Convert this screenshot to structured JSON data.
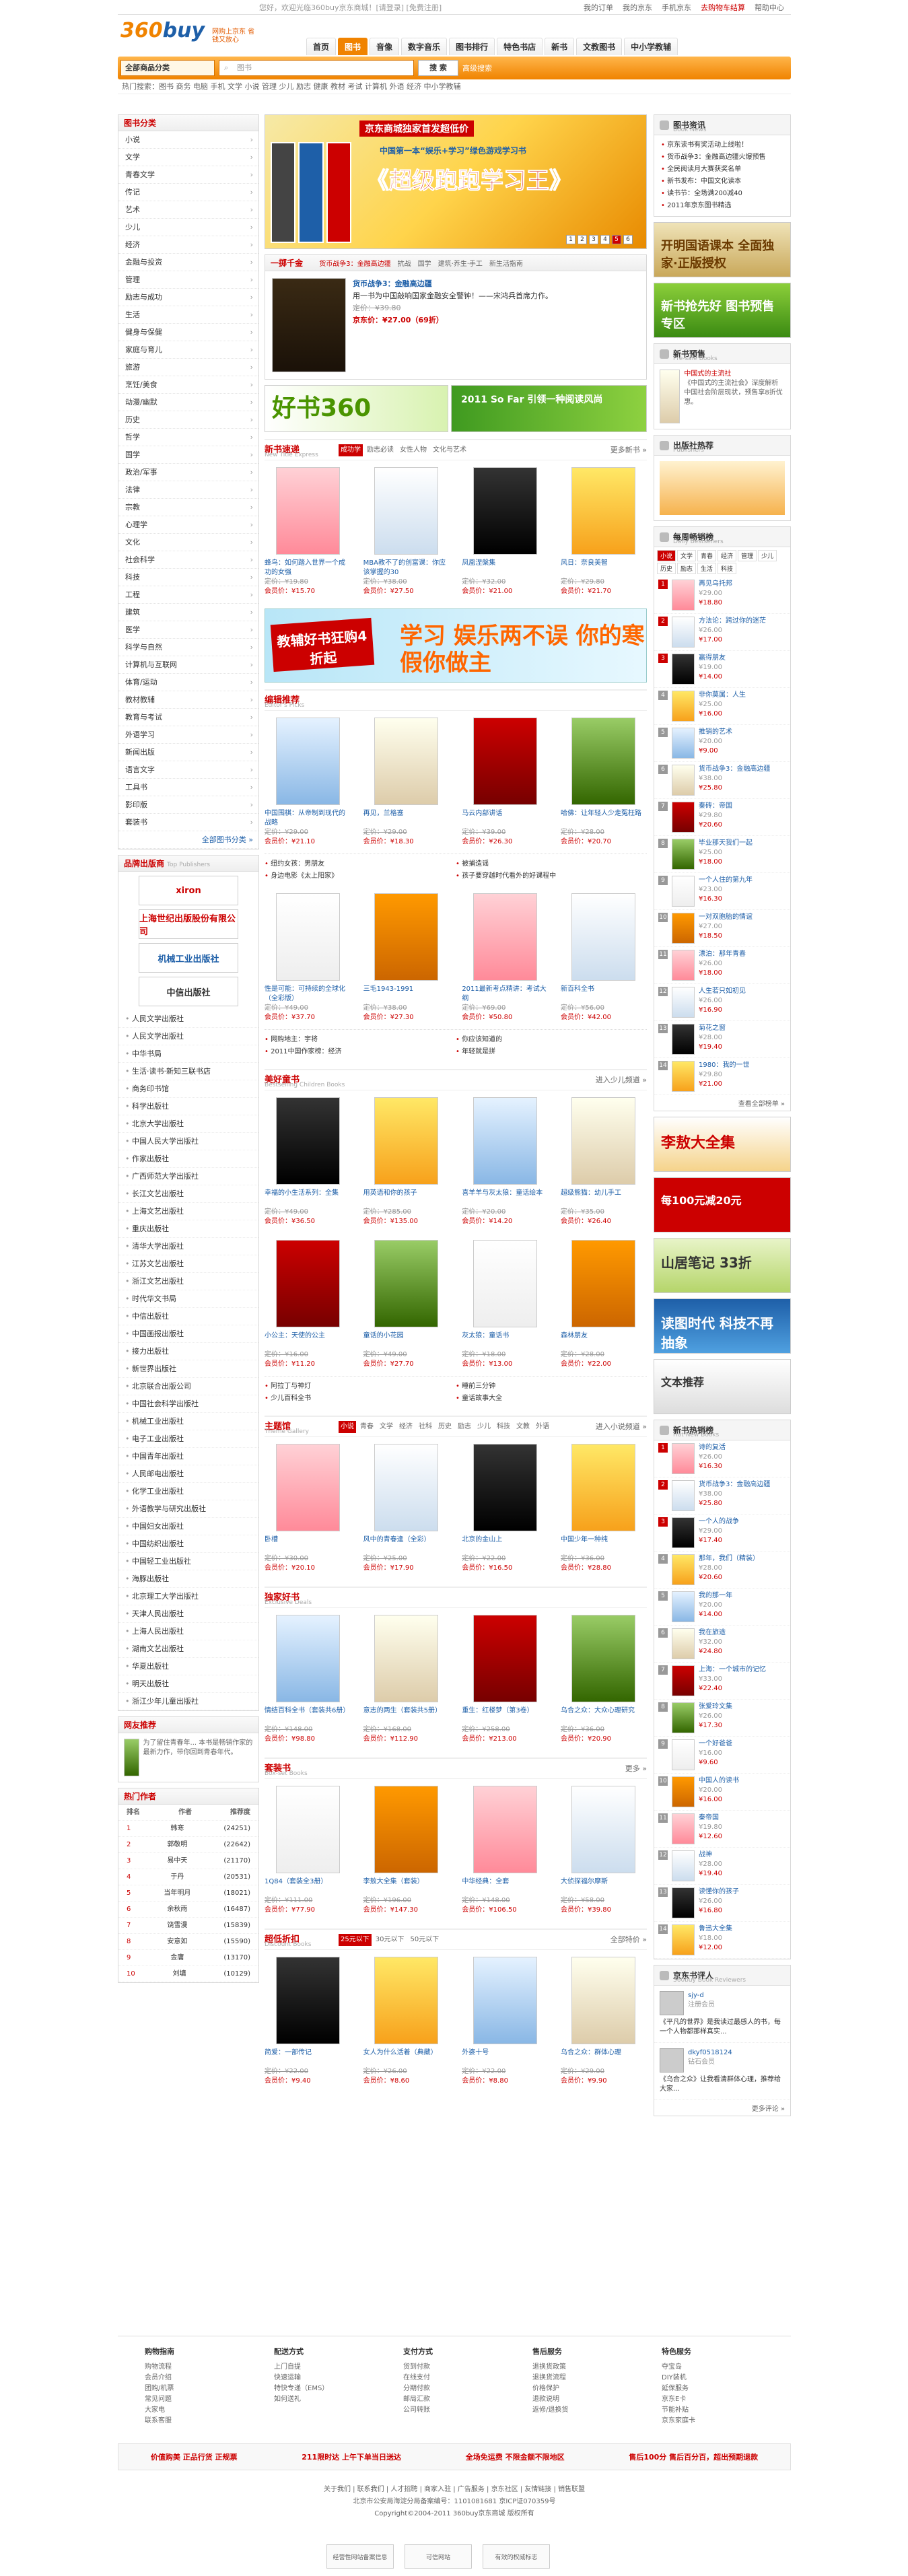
{
  "topbar": {
    "welcome": "您好，欢迎光临360buy京东商城！[请登录] [免费注册]",
    "links": [
      "我的订单",
      "我的京东",
      "手机京东",
      "去购物车结算",
      "帮助中心"
    ],
    "cart": "购物车"
  },
  "header": {
    "logo": "360buy",
    "slogan": "网购上京东 省钱又放心",
    "nav": [
      "首页",
      "图书",
      "音像",
      "数字音乐",
      "图书排行",
      "特色书店",
      "新书",
      "文教图书",
      "中小学教辅"
    ],
    "nav_on": 1
  },
  "search": {
    "category": "全部商品分类",
    "placeholder": "图书",
    "button": "搜 索",
    "advanced": "高级搜索",
    "hot": "热门搜索：图书 商务 电脑 手机 文学 小说 管理 少儿 励志 健康 教材 考试 计算机 外语 经济 中小学教辅"
  },
  "left": {
    "cat_title": "图书分类",
    "cats": [
      "小说",
      "文学",
      "青春文学",
      "传记",
      "艺术",
      "少儿",
      "经济",
      "金融与投资",
      "管理",
      "励志与成功",
      "生活",
      "健身与保健",
      "家庭与育儿",
      "旅游",
      "烹饪/美食",
      "动漫/幽默",
      "历史",
      "哲学",
      "国学",
      "政治/军事",
      "法律",
      "宗教",
      "心理学",
      "文化",
      "社会科学",
      "科技",
      "工程",
      "建筑",
      "医学",
      "科学与自然",
      "计算机与互联网",
      "体育/运动",
      "教材教辅",
      "教育与考试",
      "外语学习",
      "新闻出版",
      "语言文字",
      "工具书",
      "影印版",
      "套装书"
    ],
    "cat_more": "全部图书分类 »",
    "pub_title": "品牌出版商",
    "pub_title_en": "Top Publishers",
    "pub_logos": [
      "xiron",
      "上海世纪出版股份有限公司",
      "机械工业出版社",
      "中信出版社"
    ],
    "publishers": [
      "人民文学出版社",
      "人民文学出版社",
      "中华书局",
      "生活·读书·新知三联书店",
      "商务印书馆",
      "科学出版社",
      "北京大学出版社",
      "中国人民大学出版社",
      "作家出版社",
      "广西师范大学出版社",
      "长江文艺出版社",
      "上海文艺出版社",
      "重庆出版社",
      "清华大学出版社",
      "江苏文艺出版社",
      "浙江文艺出版社",
      "时代华文书局",
      "中信出版社",
      "中国画报出版社",
      "接力出版社",
      "新世界出版社",
      "北京联合出版公司",
      "中国社会科学出版社",
      "机械工业出版社",
      "电子工业出版社",
      "中国青年出版社",
      "人民邮电出版社",
      "化学工业出版社",
      "外语教学与研究出版社",
      "中国妇女出版社",
      "中国纺织出版社",
      "中国轻工业出版社",
      "海豚出版社",
      "北京理工大学出版社",
      "天津人民出版社",
      "上海人民出版社",
      "湖南文艺出版社",
      "华夏出版社",
      "明天出版社",
      "浙江少年儿童出版社"
    ],
    "rec_title": "网友推荐",
    "rec_text": "为了留住青春年... 本书是畅销作家的最新力作，带你回到青春年代。",
    "auth_title": "热门作者",
    "auth_head": [
      "排名",
      "作者",
      "推荐度"
    ],
    "authors": [
      [
        "1",
        "韩寒",
        "(24251)"
      ],
      [
        "2",
        "郭敬明",
        "(22642)"
      ],
      [
        "3",
        "易中天",
        "(21170)"
      ],
      [
        "4",
        "于丹",
        "(20531)"
      ],
      [
        "5",
        "当年明月",
        "(18021)"
      ],
      [
        "6",
        "余秋雨",
        "(16487)"
      ],
      [
        "7",
        "饶雪漫",
        "(15839)"
      ],
      [
        "8",
        "安意如",
        "(15590)"
      ],
      [
        "9",
        "金庸",
        "(13170)"
      ],
      [
        "10",
        "刘墉",
        "(10129)"
      ]
    ]
  },
  "main": {
    "banner": {
      "tag": "京东商城独家首发超低价",
      "sub": "中国第一本“娱乐+学习”绿色游戏学习书",
      "title": "《超级跑跑学习王》",
      "nums": [
        "1",
        "2",
        "3",
        "4",
        "5",
        "6"
      ]
    },
    "dragon": {
      "title": "一掷千金",
      "tabs": [
        "货币战争3：金融高边疆",
        "抗战",
        "国学",
        "建筑·养生·手工",
        "新生活指南"
      ],
      "book": "货币战争3：金融高边疆",
      "desc": "用一书为中国敲响国家金融安全警钟！——宋鸿兵首席力作。",
      "price_old": "定价：¥39.80",
      "price_new": "京东价：¥27.00（69折）"
    },
    "slim": [
      "好书360",
      "2011 So Far 引领一种阅读风尚"
    ],
    "wide": {
      "left": "教辅好书狂购4折起",
      "right": "学习 娱乐两不误 你的寒假你做主"
    },
    "sections": [
      {
        "name": "新书速递",
        "en": "New Title Express",
        "tabs": [
          "成功学",
          "励志必读",
          "女性人物",
          "文化与艺术"
        ],
        "items": [
          {
            "name": "蜂鸟：如何踏入世界一个成功的女强",
            "p1": "定价：¥19.80",
            "p2": "会员价：¥15.70"
          },
          {
            "name": "MBA教不了的创富课：你应该掌握的30",
            "p1": "定价：¥38.00",
            "p2": "会员价：¥27.50"
          },
          {
            "name": "凤凰涅槃集",
            "p1": "定价：¥32.00",
            "p2": "会员价：¥21.00"
          },
          {
            "name": "风日：奈良美智",
            "p1": "定价：¥29.80",
            "p2": "会员价：¥21.70"
          }
        ],
        "more": "更多新书 »"
      },
      {
        "name": "编辑推荐",
        "en": "Editor's Picks",
        "items": [
          {
            "name": "中国围棋：从帝制到现代的战略",
            "p1": "定价：¥29.00",
            "p2": "会员价：¥21.10"
          },
          {
            "name": "再见，兰格塞",
            "p1": "定价：¥29.00",
            "p2": "会员价：¥18.30"
          },
          {
            "name": "马云内部讲话",
            "p1": "定价：¥39.00",
            "p2": "会员价：¥26.30"
          },
          {
            "name": "哈佛：让年轻人少走冤枉路",
            "p1": "定价：¥28.00",
            "p2": "会员价：¥20.70"
          }
        ],
        "links": [
          "纽约女孩：男朋友",
          "被捕造谣",
          "身边电影《太上阳家》",
          "孩子要穿越时代看外的好课程中"
        ]
      },
      {
        "name": "",
        "en": "",
        "items": [
          {
            "name": "性是可能：可持续的全球化（全彩版）",
            "p1": "定价：¥49.00",
            "p2": "会员价：¥37.70"
          },
          {
            "name": "三毛1943-1991",
            "p1": "定价：¥38.00",
            "p2": "会员价：¥27.30"
          },
          {
            "name": "2011最新考点精讲：考试大纲",
            "p1": "定价：¥69.00",
            "p2": "会员价：¥50.80"
          },
          {
            "name": "新百科全书",
            "p1": "定价：¥56.00",
            "p2": "会员价：¥42.00"
          }
        ],
        "links": [
          "网购地主：宇将",
          "你应该知道的",
          "2011中国作家榜：经济",
          "年轻就是拼"
        ]
      },
      {
        "name": "美好童书",
        "en": "Bestselling Children Books",
        "items": [
          {
            "name": "幸福的小生活系列：全集",
            "p1": "定价：¥49.00",
            "p2": "会员价：¥36.50"
          },
          {
            "name": "用英语和你的孩子",
            "p1": "定价：¥285.00",
            "p2": "会员价：¥135.00"
          },
          {
            "name": "喜羊羊与灰太狼：童话绘本",
            "p1": "定价：¥20.00",
            "p2": "会员价：¥14.20"
          },
          {
            "name": "超级熊猫：幼儿手工",
            "p1": "定价：¥35.00",
            "p2": "会员价：¥26.40"
          }
        ],
        "more": "进入少儿频道 »"
      },
      {
        "name": "",
        "en": "",
        "items": [
          {
            "name": "小公主：天使的公主",
            "p1": "定价：¥16.00",
            "p2": "会员价：¥11.20"
          },
          {
            "name": "童话的小花园",
            "p1": "定价：¥49.00",
            "p2": "会员价：¥27.70"
          },
          {
            "name": "灰太狼：童话书",
            "p1": "定价：¥18.00",
            "p2": "会员价：¥13.00"
          },
          {
            "name": "森林朋友",
            "p1": "定价：¥28.00",
            "p2": "会员价：¥22.00"
          }
        ],
        "links": [
          "阿拉丁与神灯",
          "睡前三分钟",
          "少儿百科全书",
          "童话故事大全"
        ]
      },
      {
        "name": "主题馆",
        "en": "Theme Gallery",
        "tabs": [
          "小说",
          "青春",
          "文学",
          "经济",
          "社科",
          "历史",
          "励志",
          "少儿",
          "科技",
          "文教",
          "外语"
        ],
        "items": [
          {
            "name": "卧槽",
            "p1": "定价：¥30.00",
            "p2": "会员价：¥20.10"
          },
          {
            "name": "风中的青春逢（全彩）",
            "p1": "定价：¥25.00",
            "p2": "会员价：¥17.90"
          },
          {
            "name": "北京的金山上",
            "p1": "定价：¥22.00",
            "p2": "会员价：¥16.50"
          },
          {
            "name": "中国少年一种纯",
            "p1": "定价：¥36.00",
            "p2": "会员价：¥28.80"
          }
        ],
        "more": "进入小说频道 »"
      },
      {
        "name": "独家好书",
        "en": "Exclusive Deals",
        "items": [
          {
            "name": "情结百科全书（套装共6册）",
            "p1": "定价：¥148.00",
            "p2": "会员价：¥98.80"
          },
          {
            "name": "意志的两生（套装共5册）",
            "p1": "定价：¥168.00",
            "p2": "会员价：¥112.90"
          },
          {
            "name": "重生：红楼梦（第3卷）",
            "p1": "定价：¥258.00",
            "p2": "会员价：¥213.00"
          },
          {
            "name": "乌合之众：大众心理研究",
            "p1": "定价：¥36.00",
            "p2": "会员价：¥20.90"
          }
        ]
      },
      {
        "name": "套装书",
        "en": "Box-set Books",
        "items": [
          {
            "name": "1Q84（套装全3册）",
            "p1": "定价：¥111.00",
            "p2": "会员价：¥77.90"
          },
          {
            "name": "李敖大全集（套装）",
            "p1": "定价：¥196.00",
            "p2": "会员价：¥147.30"
          },
          {
            "name": "中华经典：全套",
            "p1": "定价：¥148.00",
            "p2": "会员价：¥106.50"
          },
          {
            "name": "大侦探福尔摩斯",
            "p1": "定价：¥58.00",
            "p2": "会员价：¥39.80"
          }
        ],
        "more": "更多 »"
      },
      {
        "name": "超低折扣",
        "en": "Discount Books",
        "tabs": [
          "25元以下",
          "30元以下",
          "50元以下"
        ],
        "items": [
          {
            "name": "简爱：一部传记",
            "p1": "定价：¥22.00",
            "p2": "会员价：¥9.40"
          },
          {
            "name": "女人为什么活着（典藏）",
            "p1": "定价：¥26.00",
            "p2": "会员价：¥8.60"
          },
          {
            "name": "外婆十号",
            "p1": "定价：¥22.00",
            "p2": "会员价：¥8.80"
          },
          {
            "name": "乌合之众：群体心理",
            "p1": "定价：¥29.00",
            "p2": "会员价：¥9.90"
          }
        ],
        "more": "全部特价 »"
      }
    ]
  },
  "right": {
    "news_title": "图书资讯",
    "news_en": "Book News",
    "news": [
      "京东读书有奖活动上线啦！",
      "货币战争3：金融高边疆火爆预售",
      "全民阅读月大赛获奖名单",
      "新书发布：中国文化读本",
      "读书节：全场满200减40",
      "2011年京东图书精选"
    ],
    "ads": [
      "开明国语课本 全面独家·正版授权",
      "新书抢先好 图书预售专区"
    ],
    "presell_title": "新书预售",
    "presell_en": "Pre-sale Books",
    "presell_book": "中国式的主流社",
    "presell_desc": "《中国式的主流社会》深度解析中国社会阶层现状，预售享8折优惠。",
    "publisher_title": "出版社热荐",
    "publisher_en": "Publishers",
    "rank_title": "每周畅销榜",
    "rank_en": "Daily Bestsellers",
    "rank_tabs": [
      "小说",
      "文学",
      "青春",
      "经济",
      "管理",
      "少儿",
      "历史",
      "励志",
      "生活",
      "科技"
    ],
    "rank": [
      [
        "1",
        "再见乌托邦",
        "¥29.00",
        "¥18.80"
      ],
      [
        "2",
        "方法论：跨过你的迷茫",
        "¥26.00",
        "¥17.00"
      ],
      [
        "3",
        "赢得朋友",
        "¥19.00",
        "¥14.00"
      ],
      [
        "4",
        "非你莫属：人生",
        "¥25.00",
        "¥16.00"
      ],
      [
        "5",
        "推销的艺术",
        "¥20.00",
        "¥9.00"
      ],
      [
        "6",
        "货币战争3：金融高边疆",
        "¥38.00",
        "¥25.80"
      ],
      [
        "7",
        "秦砖：帝国",
        "¥29.80",
        "¥20.60"
      ],
      [
        "8",
        "毕业那天我们一起",
        "¥25.00",
        "¥18.00"
      ],
      [
        "9",
        "一个人住的第九年",
        "¥23.00",
        "¥16.30"
      ],
      [
        "10",
        "一对双胞胎的情谊",
        "¥27.00",
        "¥18.50"
      ],
      [
        "11",
        "漂泊：那年青春",
        "¥26.00",
        "¥18.00"
      ],
      [
        "12",
        "人生若只如初见",
        "¥26.00",
        "¥16.90"
      ],
      [
        "13",
        "菊花之窗",
        "¥28.00",
        "¥19.40"
      ],
      [
        "14",
        "1980：我的一世",
        "¥29.80",
        "¥21.00"
      ]
    ],
    "rank_more": "查看全部榜单 »",
    "big_ads": [
      "李敖大全集",
      "每100元减20元",
      "山居笔记 33折",
      "读图时代 科技不再抽象",
      "文本推荐"
    ],
    "hot_title": "新书热销榜",
    "hot_en": "Hot New Books",
    "hot": [
      [
        "1",
        "诗的复活",
        "¥26.00",
        "¥16.30"
      ],
      [
        "2",
        "货币战争3：金融高边疆",
        "¥38.00",
        "¥25.80"
      ],
      [
        "3",
        "一个人的战争",
        "¥29.00",
        "¥17.40"
      ],
      [
        "4",
        "那年，我们（精装）",
        "¥28.00",
        "¥20.60"
      ],
      [
        "5",
        "我的那一年",
        "¥20.00",
        "¥14.00"
      ],
      [
        "6",
        "我在旅途",
        "¥32.00",
        "¥24.80"
      ],
      [
        "7",
        "上海：一个城市的记忆",
        "¥33.00",
        "¥22.40"
      ],
      [
        "8",
        "张爱玲文集",
        "¥26.00",
        "¥17.30"
      ],
      [
        "9",
        "一个好爸爸",
        "¥16.00",
        "¥9.60"
      ],
      [
        "10",
        "中国人的读书",
        "¥20.00",
        "¥16.00"
      ],
      [
        "11",
        "秦帝国",
        "¥19.80",
        "¥12.60"
      ],
      [
        "12",
        "战神",
        "¥28.00",
        "¥19.40"
      ],
      [
        "13",
        "读懂你的孩子",
        "¥26.00",
        "¥16.80"
      ],
      [
        "14",
        "鲁迅大全集",
        "¥18.00",
        "¥12.00"
      ]
    ],
    "review_title": "京东书评人",
    "review_en": "360buy Book Reviewers",
    "reviewers": [
      {
        "name": "sjy-d",
        "level": "注册会员",
        "text": "《平凡的世界》是我读过最感人的书，每一个人物都那样真实..."
      },
      {
        "name": "dkyf0518124",
        "level": "钻石会员",
        "text": "《乌合之众》让我看清群体心理，推荐给大家..."
      }
    ],
    "review_more": "更多评论 »"
  },
  "footer": {
    "help": [
      {
        "h": "购物指南",
        "items": [
          "购物流程",
          "会员介绍",
          "团购/机票",
          "常见问题",
          "大家电",
          "联系客服"
        ]
      },
      {
        "h": "配送方式",
        "items": [
          "上门自提",
          "快速运输",
          "特快专递（EMS）",
          "如何送礼"
        ]
      },
      {
        "h": "支付方式",
        "items": [
          "货到付款",
          "在线支付",
          "分期付款",
          "邮局汇款",
          "公司转账"
        ]
      },
      {
        "h": "售后服务",
        "items": [
          "退换货政策",
          "退换货流程",
          "价格保护",
          "退款说明",
          "返修/退换货"
        ]
      },
      {
        "h": "特色服务",
        "items": [
          "夺宝岛",
          "DIY装机",
          "延保服务",
          "京东E卡",
          "节能补贴",
          "京东家庭卡"
        ]
      }
    ],
    "service": [
      "价值购美 正品行货 正规票",
      "211限时达 上午下单当日送达",
      "全场免运费 不限金额不限地区",
      "售后100分 售后百分百，超出预期退款"
    ],
    "links": "关于我们 | 联系我们 | 人才招聘 | 商家入驻 | 广告服务 | 京东社区 | 友情链接 | 销售联盟",
    "icp": "北京市公安局海淀分局备案编号：1101081681 京ICP证070359号",
    "copy": "Copyright©2004-2011 360buy京东商城 版权所有",
    "badges": [
      "经营性网站备案信息",
      "可信网站",
      "有效的权威标志"
    ]
  }
}
